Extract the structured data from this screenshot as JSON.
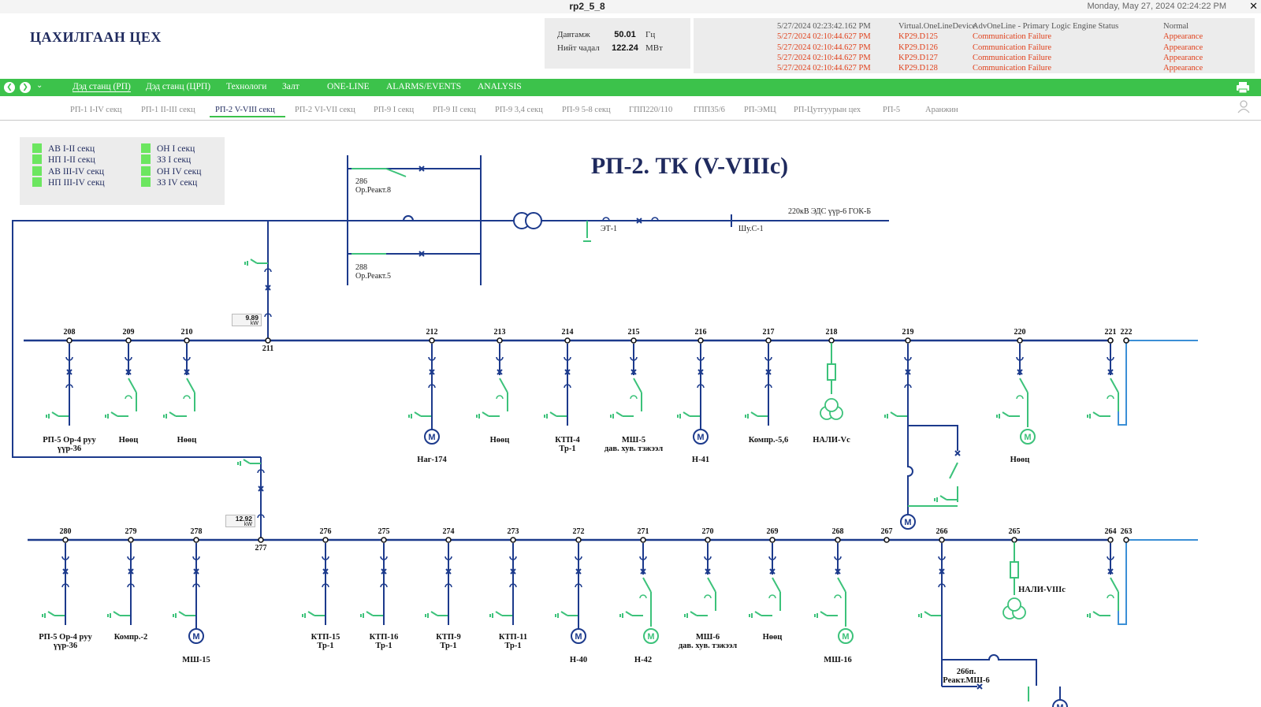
{
  "window": {
    "title": "rp2_5_8",
    "datetime": "Monday, May 27, 2024 02:24:22 PM",
    "close": "✕"
  },
  "header": {
    "plant_name": "ЦАХИЛГААН ЦЕХ",
    "frequency": {
      "label": "Давтамж",
      "value": "50.01",
      "unit": "Гц"
    },
    "total_power": {
      "label": "Нийт чадал",
      "value": "122.24",
      "unit": "МВт"
    }
  },
  "alarms": [
    {
      "time": "5/27/2024 02:23:42.162 PM",
      "source": "Virtual.OneLineDevice",
      "message": "AdvOneLine - Primary Logic Engine Status",
      "state": "Normal",
      "color": "#555555"
    },
    {
      "time": "5/27/2024 02:10:44.627 PM",
      "source": "KP29.D125",
      "message": "Communication Failure",
      "state": "Appearance",
      "color": "#e0411c"
    },
    {
      "time": "5/27/2024 02:10:44.627 PM",
      "source": "KP29.D126",
      "message": "Communication Failure",
      "state": "Appearance",
      "color": "#e0411c"
    },
    {
      "time": "5/27/2024 02:10:44.627 PM",
      "source": "KP29.D127",
      "message": "Communication Failure",
      "state": "Appearance",
      "color": "#e0411c"
    },
    {
      "time": "5/27/2024 02:10:44.627 PM",
      "source": "KP29.D128",
      "message": "Communication Failure",
      "state": "Appearance",
      "color": "#e0411c"
    }
  ],
  "nav": {
    "back": "❮",
    "forward": "❯",
    "menu": "⌄",
    "items": [
      "Дэд станц (РП)",
      "Дэд станц (ЦРП)",
      "Технологи",
      "Залт",
      "ONE-LINE",
      "ALARMS/EVENTS",
      "ANALYSIS"
    ]
  },
  "tabs": [
    "РП-1 I-IV секц",
    "РП-1 II-III секц",
    "РП-2 V-VIII секц",
    "РП-2 VI-VII секц",
    "РП-9 I секц",
    "РП-9 II секц",
    "РП-9 3,4 секц",
    "РП-9 5-8 секц",
    "ГПП220/110",
    "ГПП35/6",
    "РП-ЭМЦ",
    "РП-Цутгуурын цех",
    "РП-5",
    "Аранжин"
  ],
  "legend": [
    "АВ I-II секц",
    "НП I-II секц",
    "АВ III-IV секц",
    "НП III-IV секц",
    "ОН I секц",
    "ЗЗ I секц",
    "ОН IV секц",
    "ЗЗ IV секц"
  ],
  "diagram": {
    "title": "РП-2. ТК (V-VIIIс)",
    "incomer_label": "220кВ ЭДС үүр-6 ГОК-Б",
    "top_labels": [
      "286",
      "Ор.Реакт.8",
      "288",
      "Ор.Реакт.5",
      "ЭТ-1",
      "Шу.С-1"
    ],
    "power_upper": {
      "value": "9.89",
      "unit": "kW"
    },
    "power_lower": {
      "value": "12.92",
      "unit": "kW"
    },
    "row1_numbers": [
      "208",
      "209",
      "210",
      "211",
      "212",
      "213",
      "214",
      "215",
      "216",
      "217",
      "218",
      "219",
      "220",
      "221",
      "222"
    ],
    "row1_devices": [
      "РП-5 Ор-4 руу\nүүр-36",
      "Нөөц",
      "Нөөц",
      "Наг-174",
      "Нөөц",
      "КТП-4\nТр-1",
      "МШ-5\nдав. хув. тэжээл",
      "Н-41",
      "Компр.-5,6",
      "НАЛИ-Vс",
      "Нөөц"
    ],
    "row2_numbers": [
      "280",
      "279",
      "278",
      "277",
      "276",
      "275",
      "274",
      "273",
      "272",
      "271",
      "270",
      "269",
      "268",
      "267",
      "266",
      "265",
      "264",
      "263"
    ],
    "row2_devices": [
      "РП-5 Ор-4 руу\nүүр-36",
      "Компр.-2",
      "МШ-15",
      "КТП-15\nТр-1",
      "КТП-16\nТр-1",
      "КТП-9\nТр-1",
      "КТП-11\nТр-1",
      "Н-40",
      "Н-42",
      "МШ-6\nдав. хув. тэжээл",
      "Нөөц",
      "МШ-16",
      "НАЛИ-VIIIс",
      "266п.\nРеакт.МШ-6"
    ],
    "colors": {
      "energized": "#1c3a8c",
      "deenergized": "#3cc27a",
      "tie": "#3b8fd6"
    }
  }
}
